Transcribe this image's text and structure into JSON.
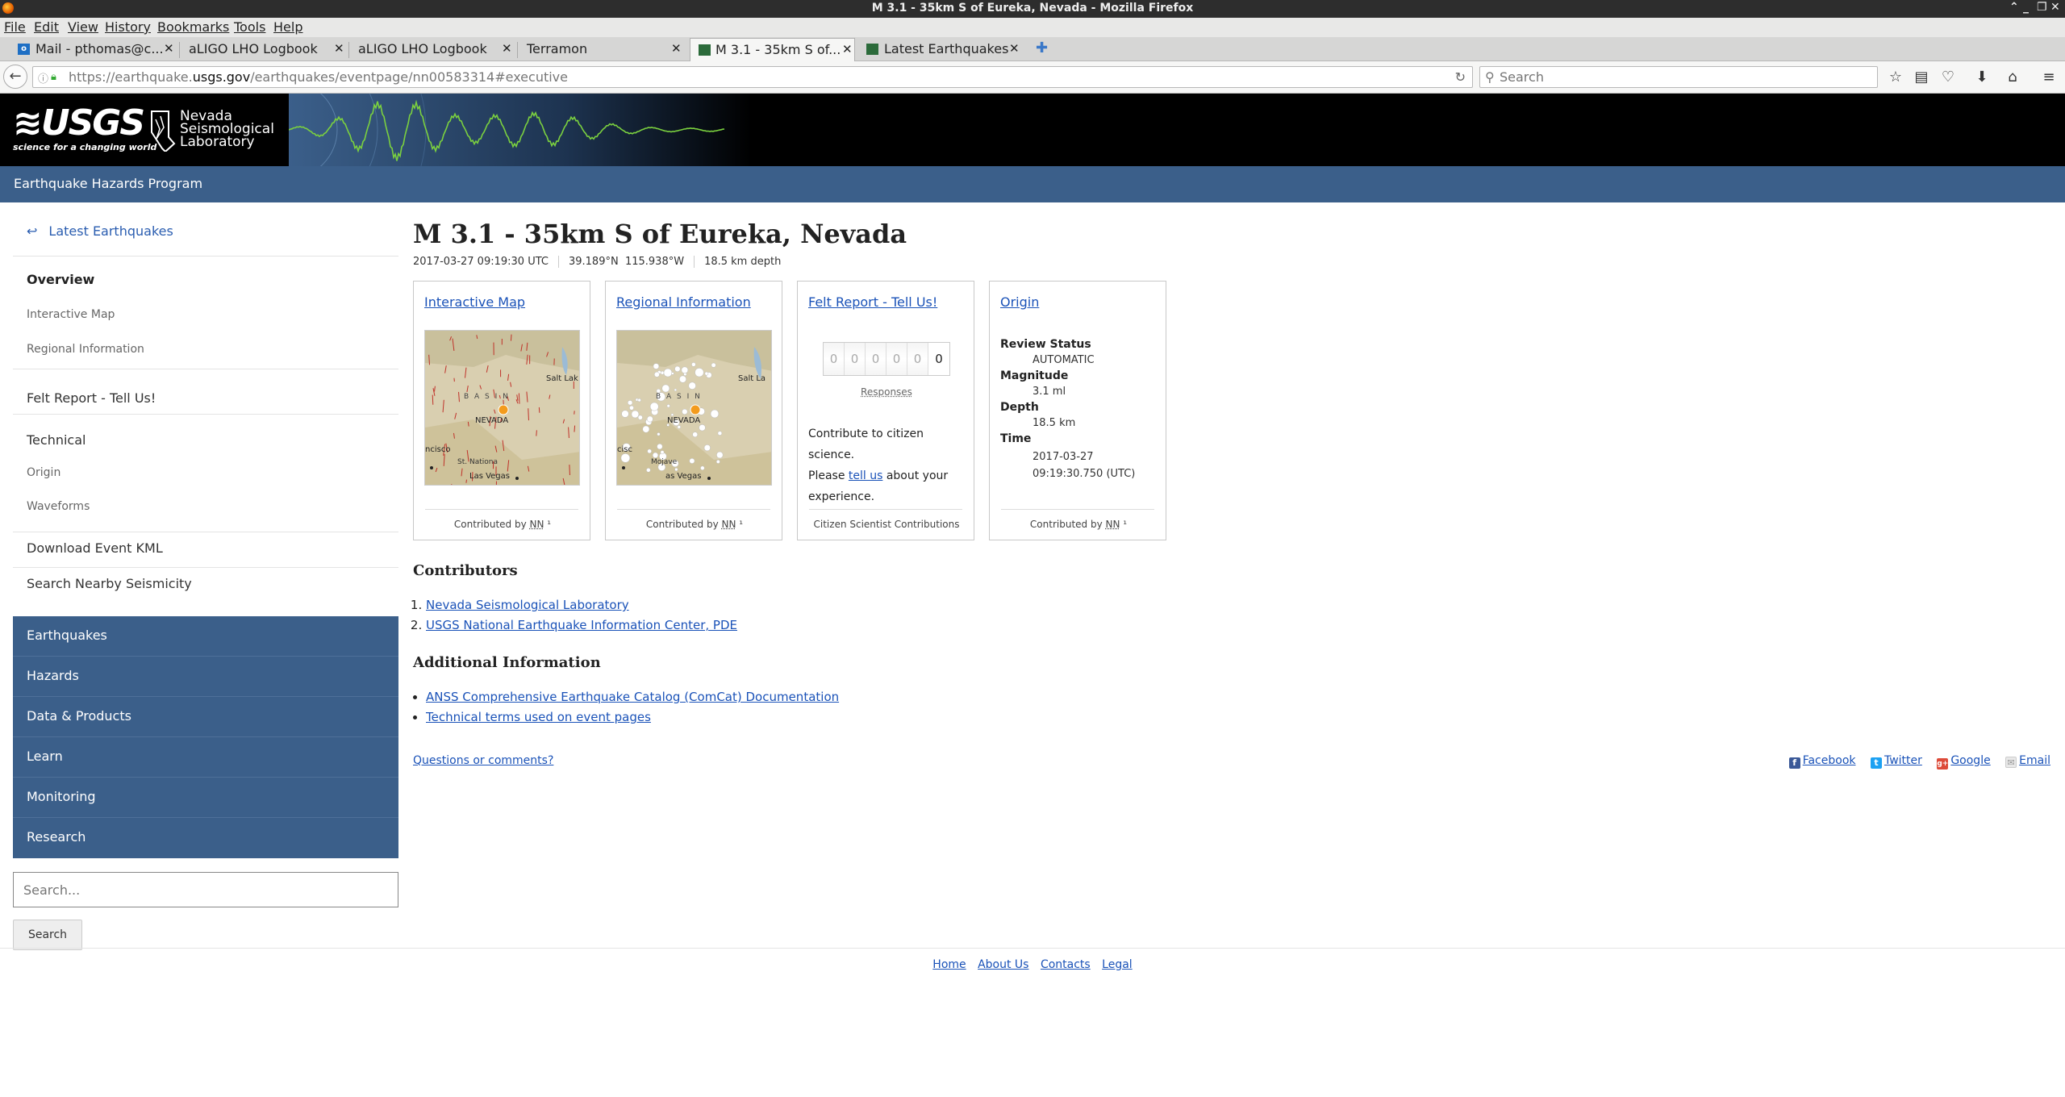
{
  "window": {
    "title": "M 3.1 - 35km S of Eureka, Nevada - Mozilla Firefox",
    "controls": [
      "⌃",
      "_",
      "❐",
      "✕"
    ]
  },
  "menu": [
    "File",
    "Edit",
    "View",
    "History",
    "Bookmarks",
    "Tools",
    "Help"
  ],
  "tabs": [
    {
      "label": "Mail - pthomas@c...",
      "icon": "outlook-icon"
    },
    {
      "label": "aLIGO LHO Logbook",
      "icon": ""
    },
    {
      "label": "aLIGO LHO Logbook",
      "icon": ""
    },
    {
      "label": "Terramon",
      "icon": ""
    },
    {
      "label": "M 3.1 - 35km S of...",
      "icon": "usgs-icon",
      "active": true
    },
    {
      "label": "Latest Earthquakes",
      "icon": "usgs-icon"
    }
  ],
  "navbar": {
    "url_prefix": "https://earthquake.",
    "url_host": "usgs.gov",
    "url_path": "/earthquakes/eventpage/nn00583314#executive",
    "search_placeholder": "Search"
  },
  "header": {
    "usgs_wordmark": "≋USGS",
    "usgs_tagline": "science for a changing world",
    "nsl_line1": "Nevada",
    "nsl_line2": "Seismological",
    "nsl_line3": "Laboratory",
    "program": "Earthquake Hazards Program"
  },
  "sidebar": {
    "back_label": "Latest Earthquakes",
    "overview": "Overview",
    "interactive_map": "Interactive Map",
    "regional_info": "Regional Information",
    "felt_report": "Felt Report - Tell Us!",
    "technical": "Technical",
    "origin": "Origin",
    "waveforms": "Waveforms",
    "download_kml": "Download Event KML",
    "search_nearby": "Search Nearby Seismicity",
    "nav": [
      "Earthquakes",
      "Hazards",
      "Data & Products",
      "Learn",
      "Monitoring",
      "Research"
    ],
    "search_placeholder": "Search...",
    "search_button": "Search"
  },
  "event": {
    "title": "M 3.1 - 35km S of Eureka, Nevada",
    "time": "2017-03-27 09:19:30 UTC",
    "coords": "39.189°N  115.938°W",
    "depth": "18.5 km depth"
  },
  "cards": {
    "interactive_map": {
      "title": "Interactive Map",
      "contrib_prefix": "Contributed by ",
      "contrib_net": "NN",
      "contrib_suffix": " ¹"
    },
    "regional": {
      "title": "Regional Information",
      "contrib_prefix": "Contributed by ",
      "contrib_net": "NN",
      "contrib_suffix": " ¹"
    },
    "felt": {
      "title": "Felt Report - Tell Us!",
      "digits": [
        "0",
        "0",
        "0",
        "0",
        "0",
        "0"
      ],
      "responses": "Responses",
      "text1": "Contribute to citizen science.",
      "text2": "Please ",
      "link": "tell us",
      "text3": " about your experience.",
      "foot": "Citizen Scientist Contributions"
    },
    "origin": {
      "title": "Origin",
      "review_label": "Review Status",
      "review_value": "AUTOMATIC",
      "mag_label": "Magnitude",
      "mag_value": "3.1 ml",
      "depth_label": "Depth",
      "depth_value": "18.5 km",
      "time_label": "Time",
      "time_value1": "2017-03-27",
      "time_value2": "09:19:30.750 (UTC)",
      "contrib_prefix": "Contributed by ",
      "contrib_net": "NN",
      "contrib_suffix": " ¹"
    }
  },
  "map_labels": {
    "salt_lake": "Salt Lak",
    "salt_lake2": "Salt La",
    "nevada": "NEVADA",
    "basin": "B A S I N",
    "francisco": "ncisco",
    "francisco2": "cisc",
    "vegas": "Las Vegas",
    "vegas2": "as Vegas",
    "st_national": "St. Nationa",
    "mojave": "Mojave"
  },
  "contributors": {
    "heading": "Contributors",
    "items": [
      "Nevada Seismological Laboratory",
      "USGS National Earthquake Information Center, PDE"
    ]
  },
  "additional": {
    "heading": "Additional Information",
    "items": [
      "ANSS Comprehensive Earthquake Catalog (ComCat) Documentation",
      "Technical terms used on event pages"
    ]
  },
  "questions": "Questions or comments?",
  "share": [
    {
      "label": "Facebook",
      "icon": "facebook-icon",
      "glyph": "f",
      "color": "#3b5998"
    },
    {
      "label": "Twitter",
      "icon": "twitter-icon",
      "glyph": "t",
      "color": "#1da1f2"
    },
    {
      "label": "Google",
      "icon": "google-plus-icon",
      "glyph": "g+",
      "color": "#dd4b39"
    },
    {
      "label": "Email",
      "icon": "email-icon",
      "glyph": "✉",
      "color": "#bbbbbb"
    }
  ],
  "footer": [
    "Home",
    "About Us",
    "Contacts",
    "Legal"
  ],
  "colors": {
    "usgs_blue": "#3b5f8a",
    "link": "#1a52b8",
    "header_black": "#000000"
  }
}
